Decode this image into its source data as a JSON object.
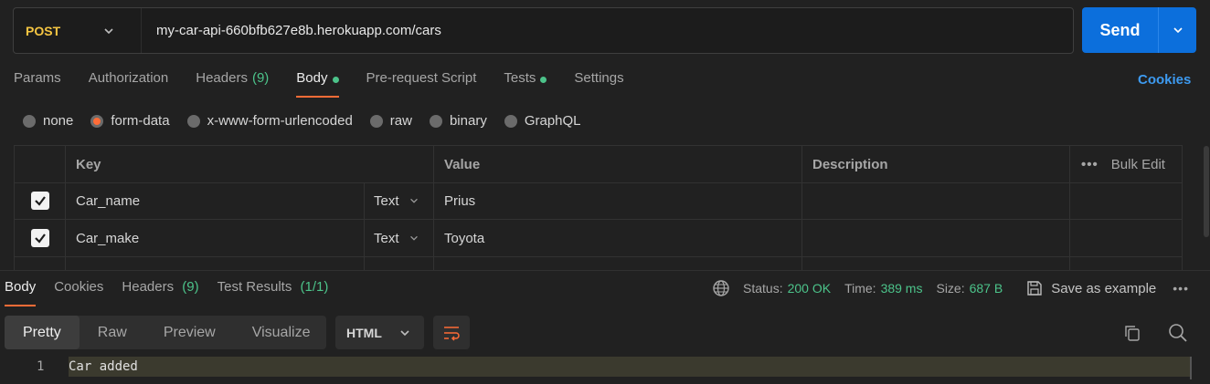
{
  "request": {
    "method": "POST",
    "url": "my-car-api-660bfb627e8b.herokuapp.com/cars",
    "send_label": "Send"
  },
  "request_tabs": [
    {
      "label": "Params"
    },
    {
      "label": "Authorization"
    },
    {
      "label": "Headers",
      "count": "(9)"
    },
    {
      "label": "Body",
      "indicator": true,
      "active": true
    },
    {
      "label": "Pre-request Script"
    },
    {
      "label": "Tests",
      "indicator": true
    },
    {
      "label": "Settings"
    }
  ],
  "cookies_link": "Cookies",
  "body_types": [
    {
      "label": "none",
      "selected": false
    },
    {
      "label": "form-data",
      "selected": true
    },
    {
      "label": "x-www-form-urlencoded",
      "selected": false
    },
    {
      "label": "raw",
      "selected": false
    },
    {
      "label": "binary",
      "selected": false
    },
    {
      "label": "GraphQL",
      "selected": false
    }
  ],
  "form_table": {
    "headers": {
      "key": "Key",
      "value": "Value",
      "description": "Description",
      "bulk_edit": "Bulk Edit"
    },
    "rows": [
      {
        "checked": true,
        "key": "Car_name",
        "type": "Text",
        "value": "Prius",
        "description": ""
      },
      {
        "checked": true,
        "key": "Car_make",
        "type": "Text",
        "value": "Toyota",
        "description": ""
      }
    ]
  },
  "response_tabs": [
    {
      "label": "Body",
      "active": true
    },
    {
      "label": "Cookies"
    },
    {
      "label": "Headers",
      "count": "(9)"
    },
    {
      "label": "Test Results",
      "count": "(1/1)"
    }
  ],
  "response_status": {
    "status_label": "Status:",
    "status_value": "200 OK",
    "time_label": "Time:",
    "time_value": "389 ms",
    "size_label": "Size:",
    "size_value": "687 B",
    "save_example": "Save as example"
  },
  "view_modes": [
    {
      "label": "Pretty",
      "active": true
    },
    {
      "label": "Raw"
    },
    {
      "label": "Preview"
    },
    {
      "label": "Visualize"
    }
  ],
  "format": "HTML",
  "response_body": [
    {
      "line": "1",
      "text": "Car added"
    }
  ],
  "colors": {
    "accent": "#ff6c37",
    "send": "#0c6fdc",
    "success": "#4cc38a",
    "method": "#f5c542",
    "link": "#3d9af0"
  }
}
